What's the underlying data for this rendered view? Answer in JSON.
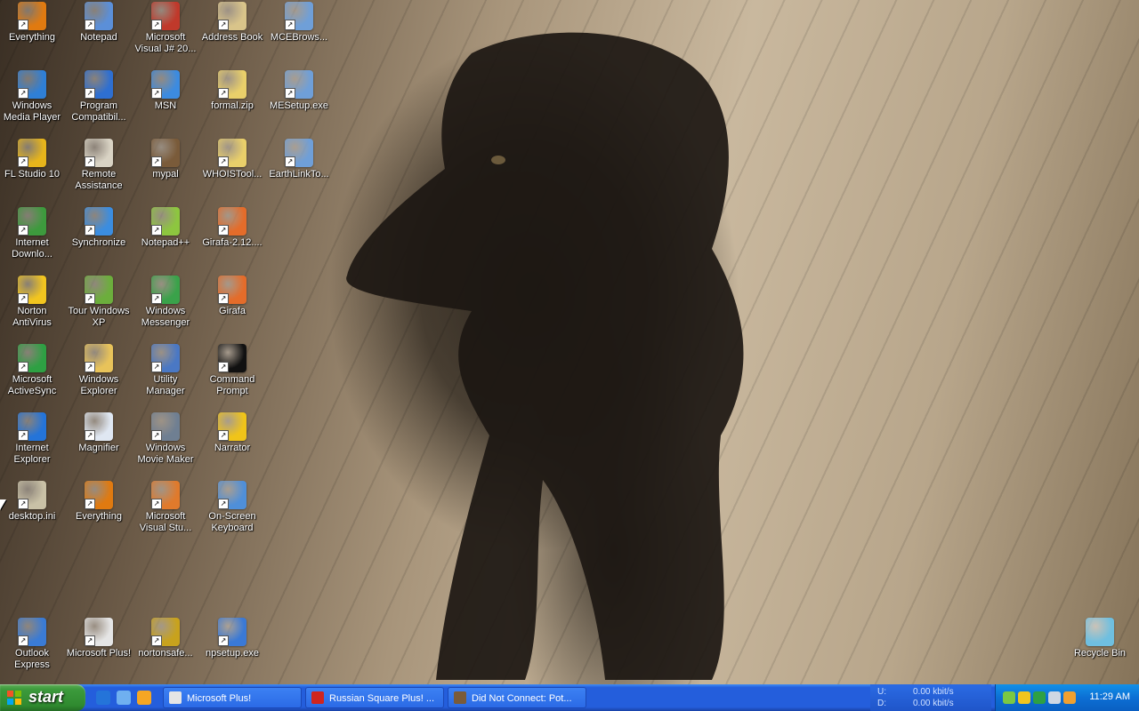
{
  "desktop_icons": [
    {
      "label": "Everything",
      "icon": "everything-icon",
      "color": "#e07a10",
      "col": 0,
      "row": 0
    },
    {
      "label": "Windows\nMedia Player",
      "icon": "media-player-icon",
      "color": "#2f7fd6",
      "col": 0,
      "row": 1
    },
    {
      "label": "FL Studio 10",
      "icon": "fl-studio-icon",
      "color": "#e7b51b",
      "col": 0,
      "row": 2
    },
    {
      "label": "Internet\nDownlo...",
      "icon": "download-manager-icon",
      "color": "#3d9a3d",
      "col": 0,
      "row": 3
    },
    {
      "label": "Norton\nAntiVirus",
      "icon": "norton-icon",
      "color": "#f2c51f",
      "col": 0,
      "row": 4
    },
    {
      "label": "Microsoft\nActiveSync",
      "icon": "activesync-icon",
      "color": "#2ea043",
      "col": 0,
      "row": 5
    },
    {
      "label": "Internet\nExplorer",
      "icon": "internet-explorer-icon",
      "color": "#2474d9",
      "col": 0,
      "row": 6
    },
    {
      "label": "desktop.ini",
      "icon": "settings-file-icon",
      "color": "#c9c1a6",
      "col": 0,
      "row": 7
    },
    {
      "label": "Outlook\nExpress",
      "icon": "outlook-express-icon",
      "color": "#3a7bd5",
      "col": 0,
      "row": 9
    },
    {
      "label": "Notepad",
      "icon": "notepad-icon",
      "color": "#5b8fd8",
      "col": 1,
      "row": 0
    },
    {
      "label": "Program\nCompatibil...",
      "icon": "help-icon",
      "color": "#2e6fd1",
      "col": 1,
      "row": 1
    },
    {
      "label": "Remote\nAssistance",
      "icon": "remote-assistance-icon",
      "color": "#d9d3c4",
      "col": 1,
      "row": 2
    },
    {
      "label": "Synchronize",
      "icon": "synchronize-icon",
      "color": "#3b8de0",
      "col": 1,
      "row": 3
    },
    {
      "label": "Tour Windows\nXP",
      "icon": "tour-xp-icon",
      "color": "#6cae3c",
      "col": 1,
      "row": 4
    },
    {
      "label": "Windows\nExplorer",
      "icon": "windows-explorer-icon",
      "color": "#e8c35a",
      "col": 1,
      "row": 5
    },
    {
      "label": "Magnifier",
      "icon": "magnifier-icon",
      "color": "#dfe7f2",
      "col": 1,
      "row": 6
    },
    {
      "label": "Everything",
      "icon": "everything-icon",
      "color": "#e07a10",
      "col": 1,
      "row": 7
    },
    {
      "label": "Microsoft Plus!",
      "icon": "microsoft-plus-icon",
      "color": "#e5e5e5",
      "col": 1,
      "row": 9
    },
    {
      "label": "Microsoft\nVisual J# 20...",
      "icon": "visual-jsharp-icon",
      "color": "#c0392b",
      "col": 2,
      "row": 0
    },
    {
      "label": "MSN",
      "icon": "msn-icon",
      "color": "#3c8be0",
      "col": 2,
      "row": 1
    },
    {
      "label": "mypal",
      "icon": "mypal-icon",
      "color": "#7a5b3a",
      "col": 2,
      "row": 2
    },
    {
      "label": "Notepad++",
      "icon": "notepad-plus-plus-icon",
      "color": "#8dc63f",
      "col": 2,
      "row": 3
    },
    {
      "label": "Windows\nMessenger",
      "icon": "windows-messenger-icon",
      "color": "#3aa24a",
      "col": 2,
      "row": 4
    },
    {
      "label": "Utility\nManager",
      "icon": "utility-manager-icon",
      "color": "#4a78c4",
      "col": 2,
      "row": 5
    },
    {
      "label": "Windows\nMovie Maker",
      "icon": "movie-maker-icon",
      "color": "#6f7f92",
      "col": 2,
      "row": 6
    },
    {
      "label": "Microsoft\nVisual Stu...",
      "icon": "visual-studio-icon",
      "color": "#e07a2c",
      "col": 2,
      "row": 7
    },
    {
      "label": "nortonsafe...",
      "icon": "norton-safe-icon",
      "color": "#c8a21d",
      "col": 2,
      "row": 9
    },
    {
      "label": "Address Book",
      "icon": "address-book-icon",
      "color": "#d9c48a",
      "col": 3,
      "row": 0
    },
    {
      "label": "formal.zip",
      "icon": "zip-folder-icon",
      "color": "#e9cf6a",
      "col": 3,
      "row": 1
    },
    {
      "label": "WHOISTool...",
      "icon": "zip-folder-icon",
      "color": "#e9cf6a",
      "col": 3,
      "row": 2
    },
    {
      "label": "Girafa-2.12....",
      "icon": "girafa-icon",
      "color": "#e46c2a",
      "col": 3,
      "row": 3
    },
    {
      "label": "Girafa",
      "icon": "girafa-icon",
      "color": "#e46c2a",
      "col": 3,
      "row": 4
    },
    {
      "label": "Command\nPrompt",
      "icon": "command-prompt-icon",
      "color": "#111111",
      "col": 3,
      "row": 5
    },
    {
      "label": "Narrator",
      "icon": "narrator-icon",
      "color": "#f0c419",
      "col": 3,
      "row": 6
    },
    {
      "label": "On-Screen\nKeyboard",
      "icon": "keyboard-icon",
      "color": "#4f8fd9",
      "col": 3,
      "row": 7
    },
    {
      "label": "npsetup.exe",
      "icon": "installer-icon",
      "color": "#3a79d6",
      "col": 3,
      "row": 9
    },
    {
      "label": "MCEBrows...",
      "icon": "installer-icon",
      "color": "#6f9fd8",
      "col": 4,
      "row": 0
    },
    {
      "label": "MESetup.exe",
      "icon": "installer-icon",
      "color": "#6f9fd8",
      "col": 4,
      "row": 1
    },
    {
      "label": "EarthLinkTo...",
      "icon": "installer-icon",
      "color": "#6f9fd8",
      "col": 4,
      "row": 2
    }
  ],
  "recycle_bin": {
    "label": "Recycle Bin",
    "icon": "recycle-bin-icon",
    "color": "#6fbfe0"
  },
  "taskbar": {
    "start_label": "start",
    "quick_launch": [
      {
        "icon": "internet-explorer-icon",
        "color": "#2474d9"
      },
      {
        "icon": "outlook-express-icon",
        "color": "#6fb0f0"
      },
      {
        "icon": "media-player-icon",
        "color": "#f5a623"
      }
    ],
    "buttons": [
      {
        "label": "Microsoft Plus!",
        "icon": "microsoft-plus-icon",
        "color": "#e5e5e5"
      },
      {
        "label": "Russian Square Plus! ...",
        "icon": "russian-square-icon",
        "color": "#d0251f"
      },
      {
        "label": "Did Not Connect: Pot...",
        "icon": "mypal-icon",
        "color": "#7a5b3a"
      }
    ],
    "bandwidth": {
      "up_label": "U:",
      "up_value": "0.00 kbit/s",
      "down_label": "D:",
      "down_value": "0.00 kbit/s"
    },
    "tray_icons": [
      {
        "icon": "network-icon",
        "color": "#7ac943"
      },
      {
        "icon": "norton-tray-icon",
        "color": "#f2c51f"
      },
      {
        "icon": "activesync-tray-icon",
        "color": "#2ea043"
      },
      {
        "icon": "clock-tray-icon",
        "color": "#cfd8e3"
      },
      {
        "icon": "search-tray-icon",
        "color": "#f0a030"
      }
    ],
    "clock": "11:29 AM"
  }
}
